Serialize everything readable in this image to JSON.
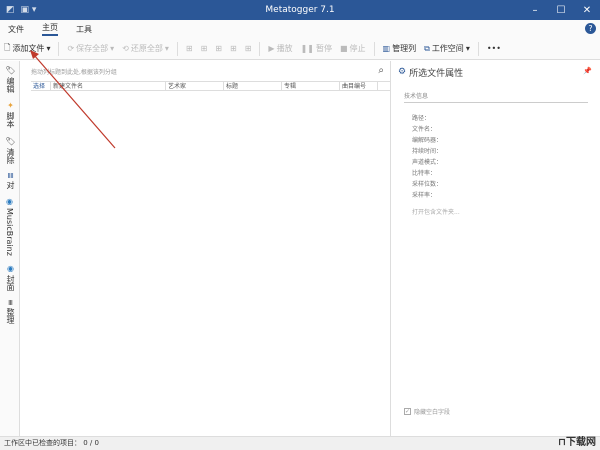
{
  "window": {
    "title": "Metatogger 7.1"
  },
  "menu": [
    "文件",
    "主页",
    "工具"
  ],
  "toolbar": {
    "add_files": "添加文件",
    "save_all": "保存全部",
    "restore_all": "还原全部",
    "play": "播放",
    "pause": "暂停",
    "stop": "停止",
    "manage_columns": "管理列",
    "workspace": "工作空间",
    "more": "•••"
  },
  "sidebar": [
    "编辑",
    "脚本",
    "清除",
    "对",
    "MusicBrainz",
    "封面",
    "整理"
  ],
  "main": {
    "group_hint": "拖动列标题到此处,根据该列分组",
    "columns": [
      "选择",
      "新建文件名",
      "艺术家",
      "标题",
      "专辑",
      "曲目编号"
    ]
  },
  "panel": {
    "title": "所选文件属性",
    "section": "技术信息",
    "fields": [
      "路径：",
      "文件名：",
      "编解码器：",
      "持续时间：",
      "声道模式：",
      "比特率：",
      "采样位数：",
      "采样率："
    ],
    "open_folder": "打开包含文件夹...",
    "hide_empty": "隐藏空白字段",
    "hide_empty_checked": true
  },
  "status": {
    "label": "工作区中已检查的项目：",
    "value": "0 / 0"
  },
  "watermark": "下载网",
  "colors": {
    "titlebar": "#2b5797",
    "annotation": "#c0392b"
  }
}
